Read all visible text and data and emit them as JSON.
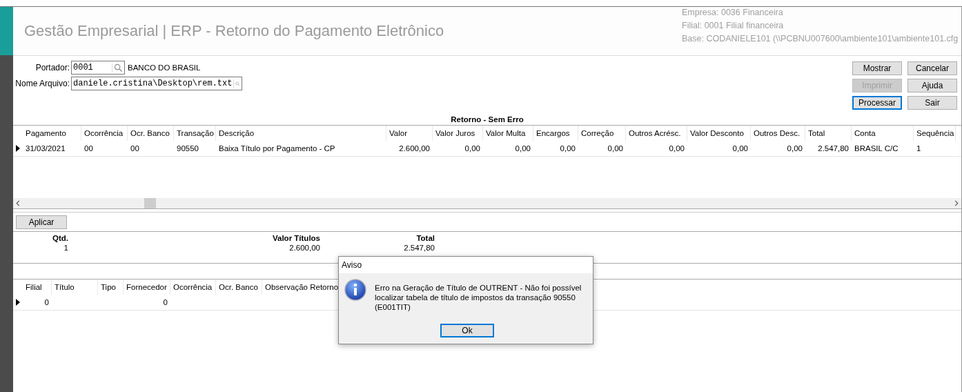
{
  "header": {
    "title": "Gestão Empresarial | ERP - Retorno do Pagamento Eletrônico",
    "info": [
      "Empresa: 0036 Financeira",
      "Filial: 0001 Filial financeira",
      "Base: CODANIELE101 (\\\\PCBNU007600\\ambiente101\\ambiente101.cfg"
    ]
  },
  "form": {
    "fields": [
      {
        "label": "Portador:",
        "value": "0001",
        "description": "BANCO DO BRASIL"
      },
      {
        "label": "Nome Arquivo:",
        "value": "daniele.cristina\\Desktop\\rem.txt"
      }
    ]
  },
  "buttons": [
    {
      "label": "Mostrar",
      "disabled": false,
      "focused": false
    },
    {
      "label": "Cancelar",
      "disabled": false,
      "focused": false
    },
    {
      "label": "Imprimir",
      "disabled": true,
      "focused": false
    },
    {
      "label": "Ajuda",
      "disabled": false,
      "focused": false
    },
    {
      "label": "Processar",
      "disabled": false,
      "focused": true
    },
    {
      "label": "Sair",
      "disabled": false,
      "focused": false
    }
  ],
  "main_table": {
    "title": "Retorno - Sem Erro",
    "columns": [
      "Pagamento",
      "Ocorrência",
      "Ocr. Banco",
      "Transação",
      "Descrição",
      "Valor",
      "Valor Juros",
      "Valor Multa",
      "Encargos",
      "Correção",
      "Outros Acrésc.",
      "Valor Desconto",
      "Outros Desc.",
      "Total",
      "Conta",
      "Sequência"
    ],
    "rows": [
      {
        "current": true,
        "cells": [
          "31/03/2021",
          "00",
          "00",
          "90550",
          "Baixa Título por Pagamento - CP",
          "2.600,00",
          "0,00",
          "0,00",
          "0,00",
          "0,00",
          "0,00",
          "0,00",
          "0,00",
          "2.547,80",
          "BRASIL C/C",
          "1"
        ]
      }
    ]
  },
  "apply_button": {
    "label": "Aplicar"
  },
  "summary": [
    {
      "label": "Qtd.",
      "value": "1"
    },
    {
      "label": "Valor Títulos",
      "value": "2.600,00"
    },
    {
      "label": "Total",
      "value": "2.547,80"
    }
  ],
  "detail_table": {
    "columns": [
      "Filial",
      "Título",
      "Tipo",
      "Fornecedor",
      "Ocorrência",
      "Ocr. Banco",
      "Observação Retorno"
    ],
    "rows": [
      {
        "current": true,
        "cells": [
          "0",
          "",
          "",
          "0",
          "",
          "",
          ""
        ]
      }
    ]
  },
  "dialog": {
    "title": "Aviso",
    "message": "Erro na Geração de Título de OUTRENT - Não foi possível localizar tabela de título de impostos da transação 90550 (E001TIT)",
    "button": "Ok"
  }
}
